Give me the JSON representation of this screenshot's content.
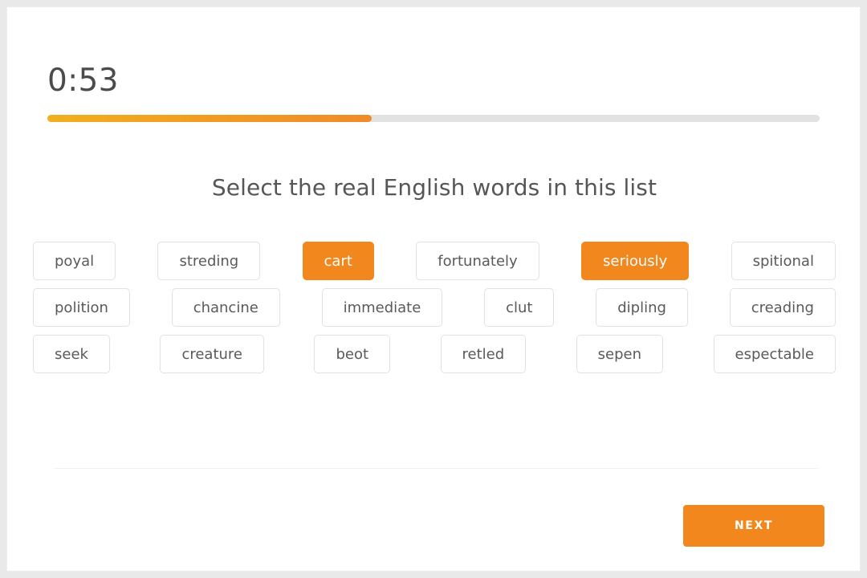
{
  "timer": {
    "value": "0:53"
  },
  "progress": {
    "percent": 42,
    "fill_start_color": "#f0b01f",
    "fill_end_color": "#ef8b2a",
    "track_color": "#e2e2e2"
  },
  "question": {
    "title": "Select the real English words in this list"
  },
  "theme": {
    "accent": "#f2871d",
    "text": "#5a5a5a",
    "border": "#e2e2e2",
    "page_background": "#e9e9e9",
    "card_background": "#ffffff"
  },
  "word_grid": {
    "rows": [
      [
        {
          "label": "poyal",
          "selected": false
        },
        {
          "label": "streding",
          "selected": false
        },
        {
          "label": "cart",
          "selected": true
        },
        {
          "label": "fortunately",
          "selected": false
        },
        {
          "label": "seriously",
          "selected": true
        },
        {
          "label": "spitional",
          "selected": false
        }
      ],
      [
        {
          "label": "polition",
          "selected": false
        },
        {
          "label": "chancine",
          "selected": false
        },
        {
          "label": "immediate",
          "selected": false
        },
        {
          "label": "clut",
          "selected": false
        },
        {
          "label": "dipling",
          "selected": false
        },
        {
          "label": "creading",
          "selected": false
        }
      ],
      [
        {
          "label": "seek",
          "selected": false
        },
        {
          "label": "creature",
          "selected": false
        },
        {
          "label": "beot",
          "selected": false
        },
        {
          "label": "retled",
          "selected": false
        },
        {
          "label": "sepen",
          "selected": false
        },
        {
          "label": "espectable",
          "selected": false
        }
      ]
    ]
  },
  "footer": {
    "next_label": "NEXT"
  }
}
